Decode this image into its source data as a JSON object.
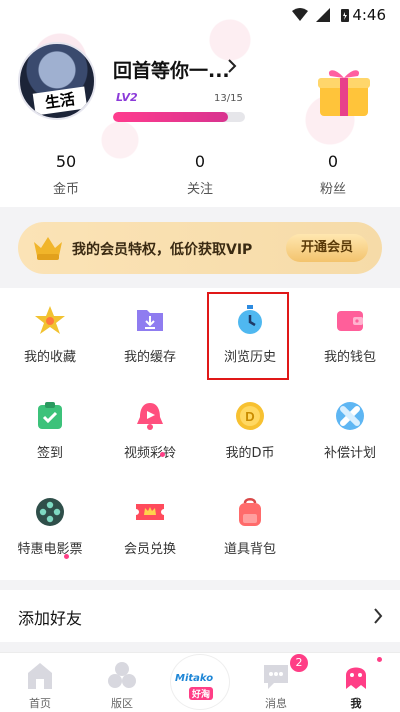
{
  "status_bar": {
    "time": "4:46"
  },
  "profile": {
    "avatar_text": "生活",
    "username": "回首等你一...",
    "level": "LV2",
    "progress_text": "13/15",
    "progress_fraction": 0.87
  },
  "stats": [
    {
      "value": "50",
      "label": "金币"
    },
    {
      "value": "0",
      "label": "关注"
    },
    {
      "value": "0",
      "label": "粉丝"
    }
  ],
  "vip": {
    "text": "我的会员特权，低价获取VIP",
    "button": "开通会员",
    "icon": "crown-vip-icon"
  },
  "menu": [
    {
      "label": "我的收藏",
      "icon": "star-icon"
    },
    {
      "label": "我的缓存",
      "icon": "download-folder-icon"
    },
    {
      "label": "浏览历史",
      "icon": "stopwatch-icon"
    },
    {
      "label": "我的钱包",
      "icon": "wallet-icon"
    },
    {
      "label": "签到",
      "icon": "check-clipboard-icon"
    },
    {
      "label": "视频彩铃",
      "icon": "bell-play-icon"
    },
    {
      "label": "我的D币",
      "icon": "coin-d-icon"
    },
    {
      "label": "补偿计划",
      "icon": "bandage-icon"
    },
    {
      "label": "特惠电影票",
      "icon": "film-reel-icon"
    },
    {
      "label": "会员兑换",
      "icon": "ticket-crown-icon"
    },
    {
      "label": "道具背包",
      "icon": "backpack-icon"
    }
  ],
  "add_friend": {
    "label": "添加好友"
  },
  "tabbar": {
    "home": "首页",
    "board": "版区",
    "logo_line1": "Mitako",
    "logo_line2": "好淘",
    "messages": "消息",
    "messages_badge": "2",
    "me": "我"
  },
  "colors": {
    "accent": "#ff3e86",
    "vip_gold": "#f6dba8",
    "highlight": "#e01818"
  }
}
